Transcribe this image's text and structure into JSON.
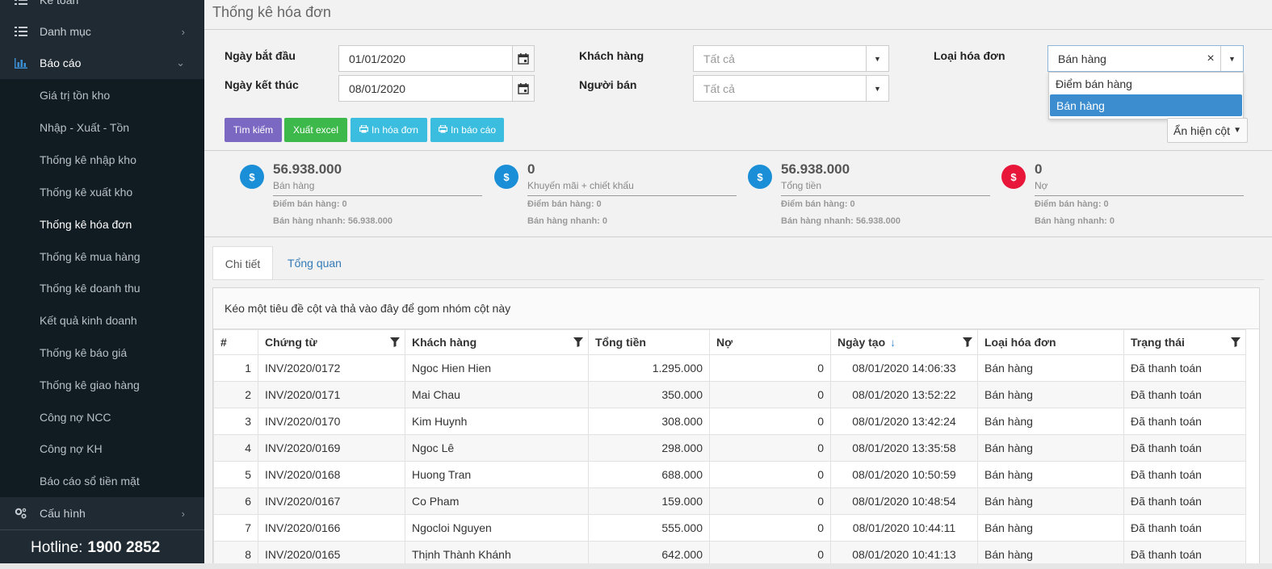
{
  "sidebar": {
    "top_items": [
      {
        "label": "Kế toán",
        "icon": "list-icon"
      },
      {
        "label": "Danh mục",
        "icon": "list-icon"
      },
      {
        "label": "Báo cáo",
        "icon": "bar-chart-icon"
      }
    ],
    "report_items": [
      "Giá trị tồn kho",
      "Nhập - Xuất - Tồn",
      "Thống kê nhập kho",
      "Thống kê xuất kho",
      "Thống kê hóa đơn",
      "Thống kê mua hàng",
      "Thống kê doanh thu",
      "Kết quả kinh doanh",
      "Thống kê báo giá",
      "Thống kê giao hàng",
      "Công nợ NCC",
      "Công nợ KH",
      "Báo cáo sổ tiền mặt"
    ],
    "active_item": "Thống kê hóa đơn",
    "config_item": {
      "label": "Cấu hình",
      "icon": "gears-icon"
    },
    "hotline_label": "Hotline:",
    "hotline_number": "1900 2852"
  },
  "page": {
    "title": "Thống kê hóa đơn"
  },
  "filters": {
    "start_label": "Ngày bắt đầu",
    "start_value": "01/01/2020",
    "end_label": "Ngày kết thúc",
    "end_value": "08/01/2020",
    "customer_label": "Khách hàng",
    "customer_placeholder": "Tất cả",
    "seller_label": "Người bán",
    "seller_placeholder": "Tất cả",
    "invoice_type_label": "Loại hóa đơn",
    "invoice_type_value": "Bán hàng",
    "invoice_type_options": [
      "Điểm bán hàng",
      "Bán hàng"
    ]
  },
  "buttons": {
    "search": "Tìm kiếm",
    "export_excel": "Xuất excel",
    "print_invoice": "In hóa đơn",
    "print_report": "In báo cáo",
    "toggle_columns": "Ẩn hiện cột"
  },
  "colors": {
    "search": "#7b68c2",
    "export": "#3db84a",
    "print": "#3bbde0",
    "coin_blue": "#1a8fd8",
    "coin_red": "#e8173a"
  },
  "summary": [
    {
      "amount": "56.938.000",
      "label": "Bán hàng",
      "line1": "Điểm bán hàng: 0",
      "line2": "Bán hàng nhanh: 56.938.000",
      "color": "blue"
    },
    {
      "amount": "0",
      "label": "Khuyến mãi + chiết khấu",
      "line1": "Điểm bán hàng: 0",
      "line2": "Bán hàng nhanh: 0",
      "color": "blue"
    },
    {
      "amount": "56.938.000",
      "label": "Tổng tiền",
      "line1": "Điểm bán hàng: 0",
      "line2": "Bán hàng nhanh: 56.938.000",
      "color": "blue"
    },
    {
      "amount": "0",
      "label": "Nợ",
      "line1": "Điểm bán hàng: 0",
      "line2": "Bán hàng nhanh: 0",
      "color": "red"
    }
  ],
  "tabs": [
    "Chi tiết",
    "Tổng quan"
  ],
  "grid": {
    "group_hint": "Kéo một tiêu đề cột và thả vào đây để gom nhóm cột này",
    "columns": [
      "#",
      "Chứng từ",
      "Khách hàng",
      "Tổng tiền",
      "Nợ",
      "Ngày tạo",
      "Loại hóa đơn",
      "Trạng thái"
    ],
    "rows": [
      [
        "1",
        "INV/2020/0172",
        "Ngoc Hien Hien",
        "1.295.000",
        "0",
        "08/01/2020 14:06:33",
        "Bán hàng",
        "Đã thanh toán"
      ],
      [
        "2",
        "INV/2020/0171",
        "Mai Chau",
        "350.000",
        "0",
        "08/01/2020 13:52:22",
        "Bán hàng",
        "Đã thanh toán"
      ],
      [
        "3",
        "INV/2020/0170",
        "Kim Huynh",
        "308.000",
        "0",
        "08/01/2020 13:42:24",
        "Bán hàng",
        "Đã thanh toán"
      ],
      [
        "4",
        "INV/2020/0169",
        "Ngoc Lê",
        "298.000",
        "0",
        "08/01/2020 13:35:58",
        "Bán hàng",
        "Đã thanh toán"
      ],
      [
        "5",
        "INV/2020/0168",
        "Huong Tran",
        "688.000",
        "0",
        "08/01/2020 10:50:59",
        "Bán hàng",
        "Đã thanh toán"
      ],
      [
        "6",
        "INV/2020/0167",
        "Co Pham",
        "159.000",
        "0",
        "08/01/2020 10:48:54",
        "Bán hàng",
        "Đã thanh toán"
      ],
      [
        "7",
        "INV/2020/0166",
        "Ngocloi Nguyen",
        "555.000",
        "0",
        "08/01/2020 10:44:11",
        "Bán hàng",
        "Đã thanh toán"
      ],
      [
        "8",
        "INV/2020/0165",
        "Thịnh Thành Khánh",
        "642.000",
        "0",
        "08/01/2020 10:41:13",
        "Bán hàng",
        "Đã thanh toán"
      ]
    ]
  }
}
